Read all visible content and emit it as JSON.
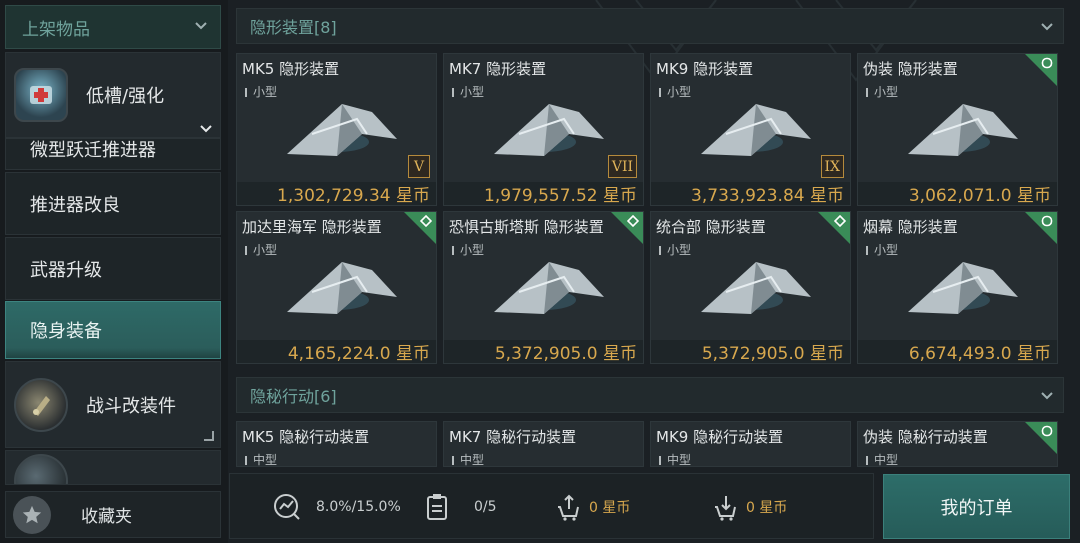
{
  "sidebar": {
    "filter_label": "上架物品",
    "categories": [
      {
        "label": "低槽/强化"
      },
      {
        "label": "微型跃迁推进器"
      },
      {
        "label": "推进器改良"
      },
      {
        "label": "武器升级"
      },
      {
        "label": "隐身装备"
      },
      {
        "label": "战斗改装件"
      }
    ],
    "favorites_label": "收藏夹"
  },
  "sections": [
    {
      "title": "隐形装置[8]",
      "items": [
        {
          "name": "MK5 隐形装置",
          "size": "小型",
          "tier": "V",
          "price": "1,302,729.34 星币"
        },
        {
          "name": "MK7 隐形装置",
          "size": "小型",
          "tier": "VII",
          "price": "1,979,557.52 星币"
        },
        {
          "name": "MK9 隐形装置",
          "size": "小型",
          "tier": "IX",
          "price": "3,733,923.84 星币"
        },
        {
          "name": "伪装 隐形装置",
          "size": "小型",
          "tag": "circle",
          "price": "3,062,071.0 星币"
        },
        {
          "name": "加达里海军 隐形装置",
          "size": "小型",
          "tag": "diamond",
          "price": "4,165,224.0 星币"
        },
        {
          "name": "恐惧古斯塔斯 隐形装置",
          "size": "小型",
          "tag": "diamond",
          "price": "5,372,905.0 星币"
        },
        {
          "name": "统合部 隐形装置",
          "size": "小型",
          "tag": "diamond",
          "price": "5,372,905.0 星币"
        },
        {
          "name": "烟幕 隐形装置",
          "size": "小型",
          "tag": "circle",
          "price": "6,674,493.0 星币"
        }
      ]
    },
    {
      "title": "隐秘行动[6]",
      "items": [
        {
          "name": "MK5 隐秘行动装置",
          "size": "中型"
        },
        {
          "name": "MK7 隐秘行动装置",
          "size": "中型"
        },
        {
          "name": "MK9 隐秘行动装置",
          "size": "中型"
        },
        {
          "name": "伪装 隐秘行动装置",
          "size": "中型",
          "tag": "circle"
        }
      ]
    }
  ],
  "bottom": {
    "tax": "8.0%/15.0%",
    "orders": "0/5",
    "sell_total": "0 星币",
    "buy_total": "0 星币",
    "my_orders_label": "我的订单"
  },
  "colors": {
    "accent_teal": "#2d6d69",
    "price_gold": "#d8a84e",
    "tag_green": "#3a8c58",
    "header_text": "#6fa39c"
  }
}
